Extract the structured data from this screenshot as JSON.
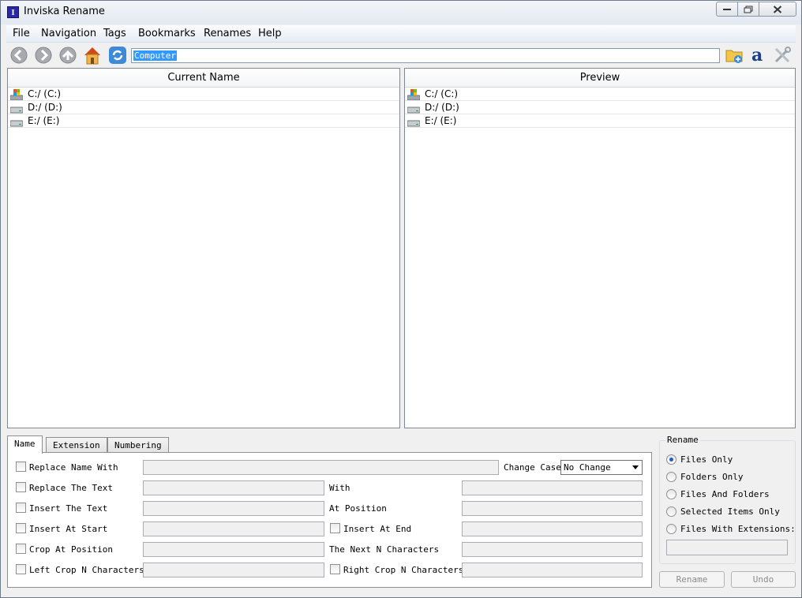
{
  "window": {
    "title": "Inviska Rename",
    "app_icon_letter": "I"
  },
  "menu": [
    "File",
    "Navigation",
    "Tags",
    "Bookmarks",
    "Renames",
    "Help"
  ],
  "toolbar": {
    "path_value": "Computer",
    "icons": [
      "back-icon",
      "forward-icon",
      "up-icon",
      "home-icon",
      "refresh-icon",
      "open-folder-icon",
      "tag-icon",
      "settings-icon"
    ]
  },
  "current_panel": {
    "header": "Current Name",
    "rows": [
      {
        "label": "C:/ (C:)",
        "icon": "system-drive-icon"
      },
      {
        "label": "D:/ (D:)",
        "icon": "drive-icon"
      },
      {
        "label": "E:/ (E:)",
        "icon": "drive-icon"
      }
    ]
  },
  "preview_panel": {
    "header": "Preview",
    "rows": [
      {
        "label": "C:/ (C:)",
        "icon": "system-drive-icon"
      },
      {
        "label": "D:/ (D:)",
        "icon": "drive-icon"
      },
      {
        "label": "E:/ (E:)",
        "icon": "drive-icon"
      }
    ]
  },
  "tabs": [
    "Name",
    "Extension",
    "Numbering"
  ],
  "name_tab": {
    "replace_name_with": "Replace Name With",
    "change_case": "Change Case",
    "change_case_value": "No Change",
    "replace_the_text": "Replace The Text",
    "with": "With",
    "insert_the_text": "Insert The Text",
    "at_position": "At Position",
    "insert_at_start": "Insert At Start",
    "insert_at_end": "Insert At End",
    "crop_at_position": "Crop At Position",
    "the_next_n_characters": "The Next N Characters",
    "left_crop": "Left Crop N Characters",
    "right_crop": "Right Crop N Characters"
  },
  "rename_group": {
    "title": "Rename",
    "options": [
      "Files Only",
      "Folders Only",
      "Files And Folders",
      "Selected Items Only",
      "Files With Extensions:"
    ],
    "selected": "Files Only",
    "rename_button": "Rename",
    "undo_button": "Undo"
  }
}
